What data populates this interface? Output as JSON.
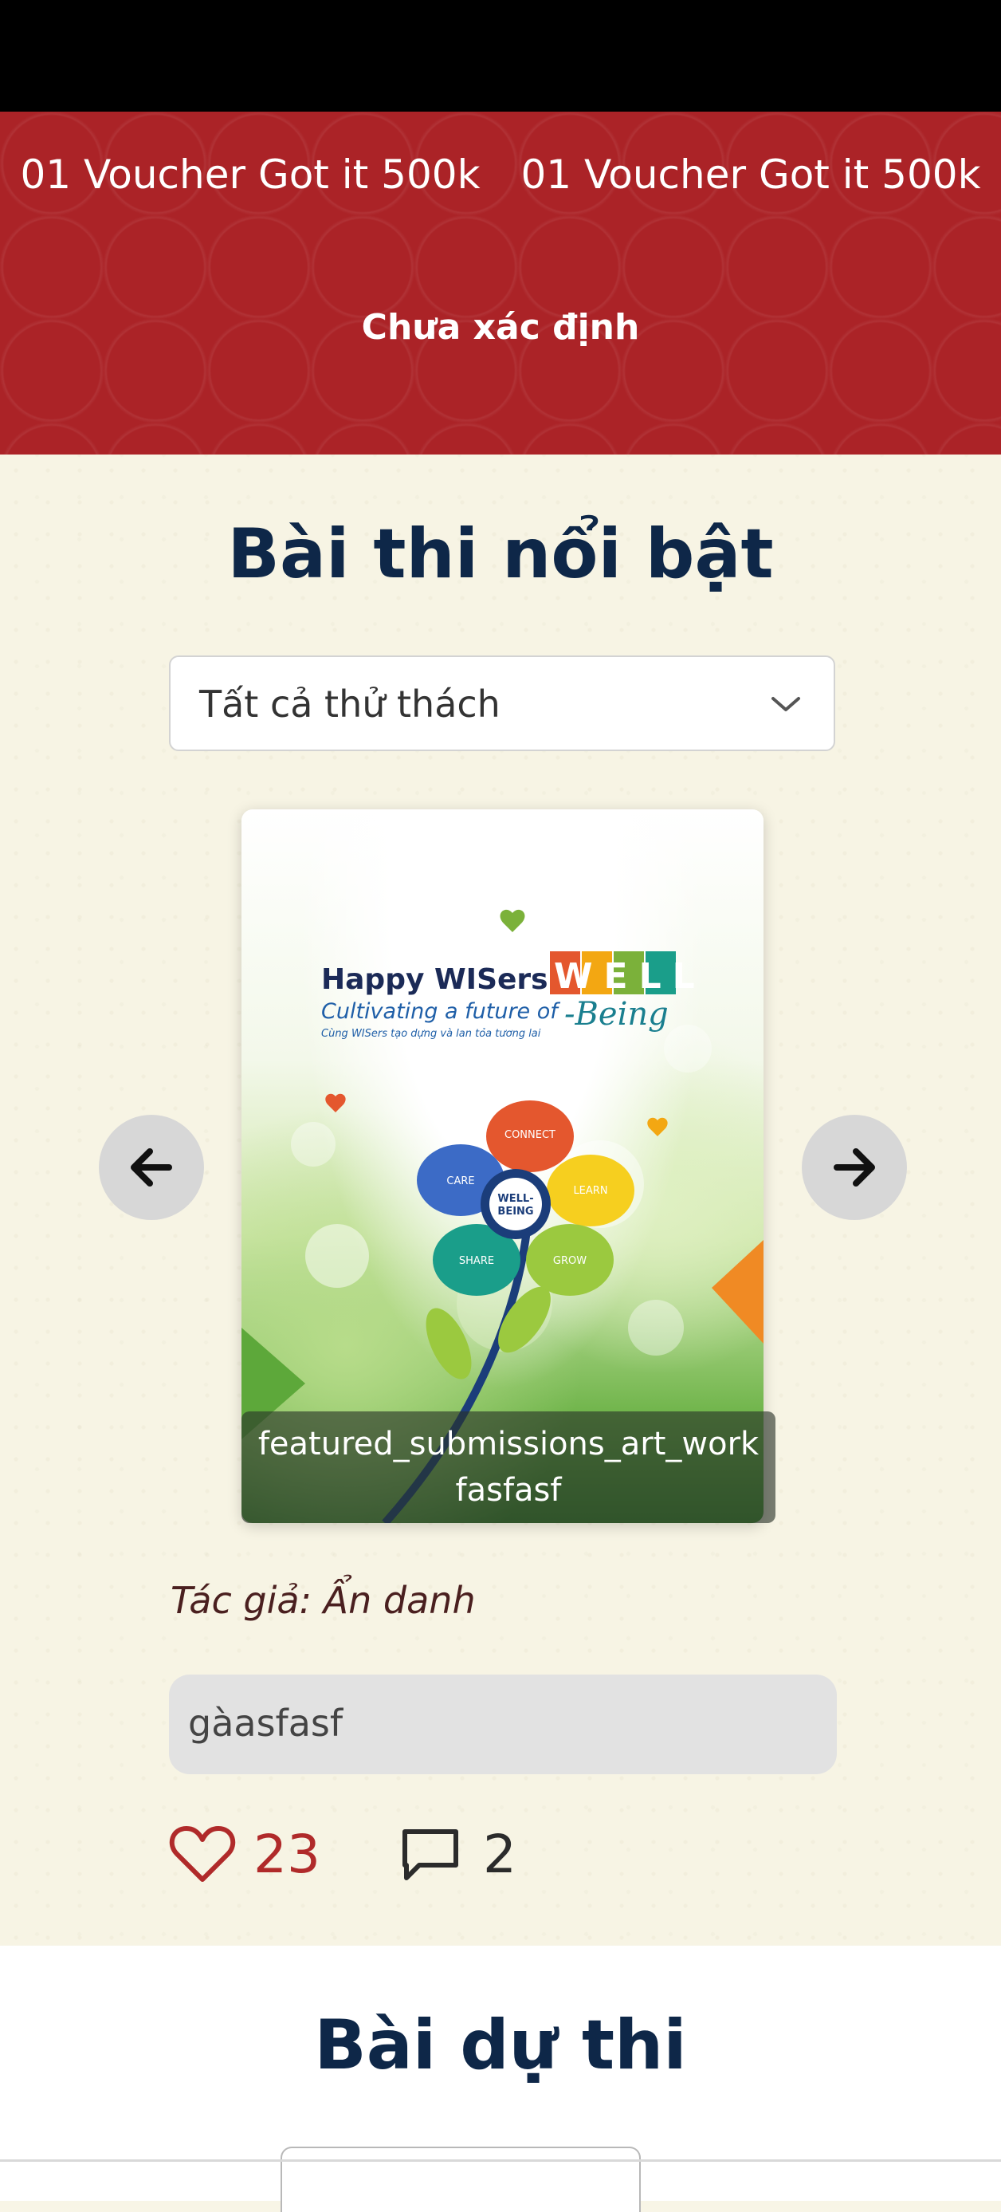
{
  "banner": {
    "prizes": [
      "01 Voucher Got it 500k",
      "01 Voucher Got it 500k"
    ],
    "status": "Chưa xác định"
  },
  "featured": {
    "title": "Bài thi nổi bật",
    "filter": {
      "selected": "Tất cả thử thách"
    },
    "card": {
      "caption_line1": "featured_submissions_art_work",
      "caption_line2": "fasfasf",
      "poster": {
        "brand": "Happy WISers",
        "tagline": "Cultivating a future of",
        "subtagline": "Cùng WISers tạo dựng và lan tỏa tương lai",
        "wordmark": "WELL",
        "wordmark2": "-Being",
        "center": "WELL-BEING",
        "petals": [
          "WISers CONNECT",
          "WISers LEARN",
          "WISers GROW",
          "WISers SHARE",
          "WISers CARE"
        ]
      }
    },
    "author": "Tác giả: Ẩn danh",
    "description": "gàasfasf",
    "likes": "23",
    "comments": "2"
  },
  "entries": {
    "title": "Bài dự thi"
  },
  "icons": {
    "prev": "arrow-left-icon",
    "next": "arrow-right-icon",
    "like": "heart-icon",
    "comment": "comment-icon",
    "dropdown": "chevron-down-icon"
  },
  "colors": {
    "banner": "#ab2327",
    "title": "#0e2748",
    "like": "#b02a2a"
  }
}
